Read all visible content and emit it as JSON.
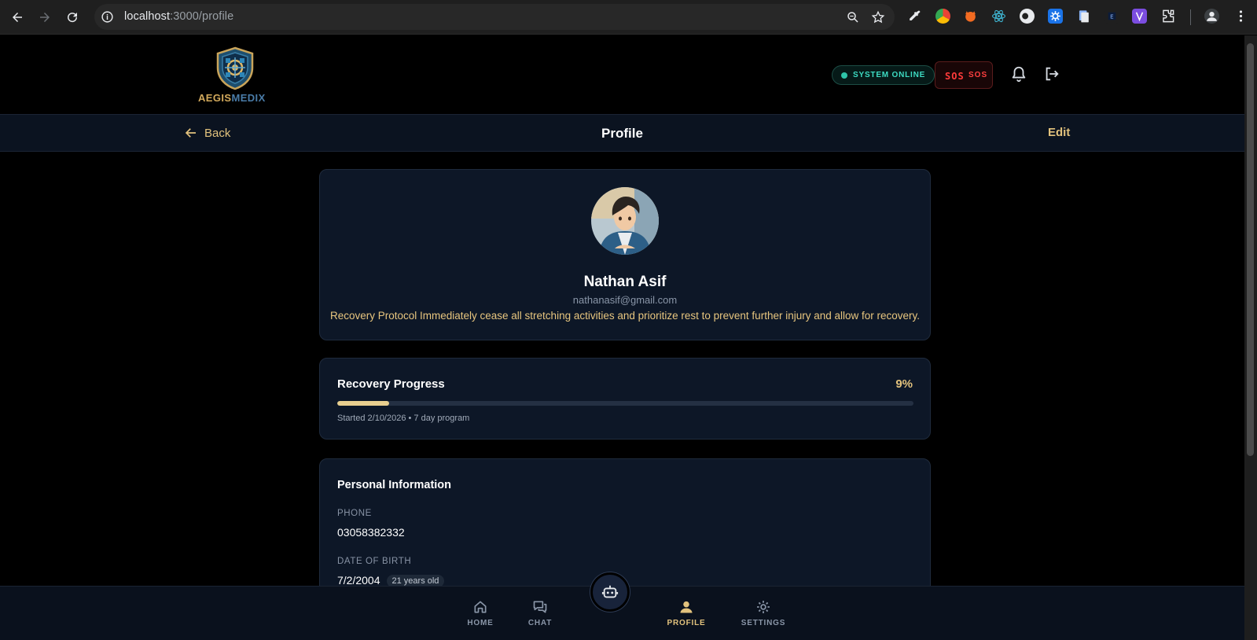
{
  "browser": {
    "url_host": "localhost",
    "url_path": ":3000/profile"
  },
  "header": {
    "logo_part1": "AEGIS",
    "logo_part2": "MEDIX",
    "system_status": "SYSTEM ONLINE",
    "sos_glyph": "SOS",
    "sos_label": "SOS"
  },
  "subheader": {
    "back_label": "Back",
    "title": "Profile",
    "edit_label": "Edit"
  },
  "profile": {
    "name": "Nathan Asif",
    "email": "nathanasif@gmail.com",
    "note": "Recovery Protocol Immediately cease all stretching activities and prioritize rest to prevent further injury and allow for recovery."
  },
  "recovery": {
    "title": "Recovery Progress",
    "percent_label": "9%",
    "percent": 9,
    "meta": "Started 2/10/2026 • 7 day program"
  },
  "personal": {
    "title": "Personal Information",
    "phone_label": "PHONE",
    "phone_value": "03058382332",
    "dob_label": "DATE OF BIRTH",
    "dob_value": "7/2/2004",
    "age": "21 years old"
  },
  "bottom_nav": {
    "home": "HOME",
    "chat": "CHAT",
    "profile": "PROFILE",
    "settings": "SETTINGS"
  },
  "colors": {
    "accent_gold": "#e2c27d",
    "status_teal": "#3ddbc2",
    "sos_red": "#ff4040",
    "card_bg": "#0d1727"
  }
}
